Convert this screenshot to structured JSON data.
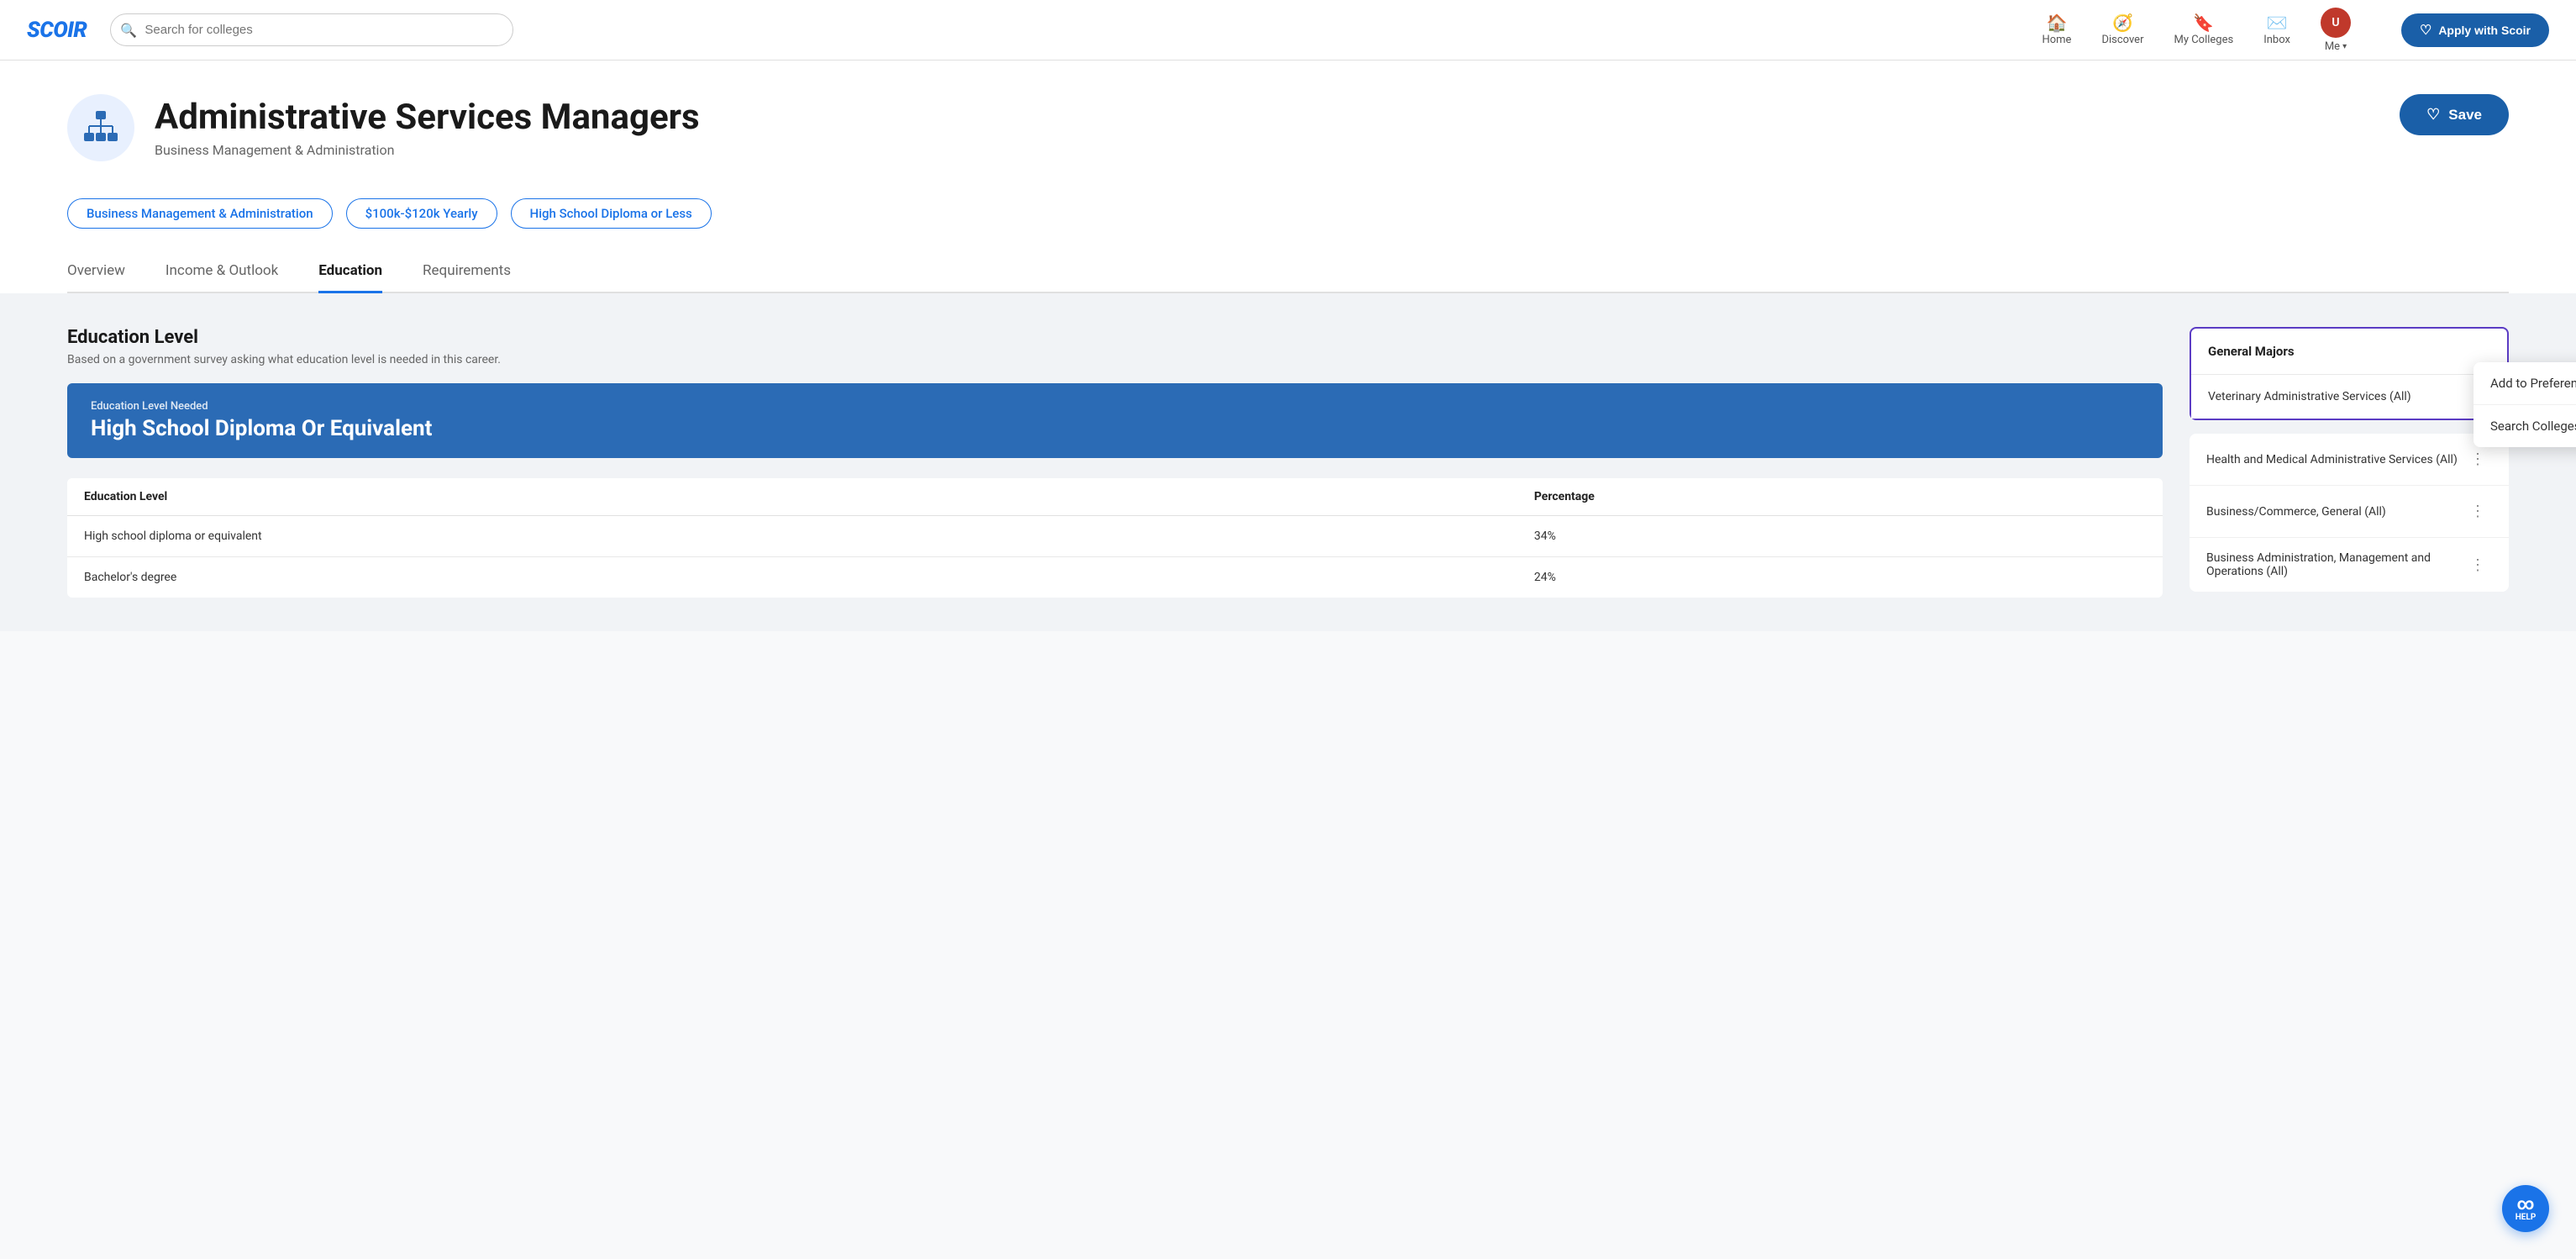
{
  "brand": {
    "name": "SCOIR",
    "logo_text": "SCOIR"
  },
  "navbar": {
    "search_placeholder": "Search for colleges",
    "nav_items": [
      {
        "id": "home",
        "label": "Home",
        "icon": "🏠"
      },
      {
        "id": "discover",
        "label": "Discover",
        "icon": "🧭"
      },
      {
        "id": "my-colleges",
        "label": "My Colleges",
        "icon": "🔖"
      },
      {
        "id": "inbox",
        "label": "Inbox",
        "icon": "✉️"
      }
    ],
    "me_label": "Me",
    "apply_label": "Apply with Scoir"
  },
  "career": {
    "title": "Administrative Services Managers",
    "subtitle": "Business Management & Administration",
    "save_label": "Save",
    "tags": [
      "Business Management & Administration",
      "$100k-$120k Yearly",
      "High School Diploma or Less"
    ]
  },
  "tabs": [
    {
      "id": "overview",
      "label": "Overview",
      "active": false
    },
    {
      "id": "income-outlook",
      "label": "Income & Outlook",
      "active": false
    },
    {
      "id": "education",
      "label": "Education",
      "active": true
    },
    {
      "id": "requirements",
      "label": "Requirements",
      "active": false
    }
  ],
  "education_section": {
    "title": "Education Level",
    "description": "Based on a government survey asking what education level is needed in this career.",
    "level_card": {
      "label": "Education Level Needed",
      "value": "High School Diploma Or Equivalent"
    },
    "table": {
      "columns": [
        "Education Level",
        "Percentage"
      ],
      "rows": [
        {
          "level": "High school diploma or equivalent",
          "percentage": "34%"
        },
        {
          "level": "Bachelor's degree",
          "percentage": "24%"
        }
      ]
    }
  },
  "right_panel": {
    "majors_header": "General Majors",
    "majors_item": "Veterinary Administrative Services (All)",
    "context_menu": {
      "items": [
        "Add to Preferences",
        "Search Colleges"
      ]
    },
    "other_majors": [
      "Health and Medical Administrative Services (All)",
      "Business/Commerce, General (All)",
      "Business Administration, Management and Operations (All)"
    ]
  },
  "help_button": {
    "symbol": "∞",
    "label": "HELP"
  }
}
